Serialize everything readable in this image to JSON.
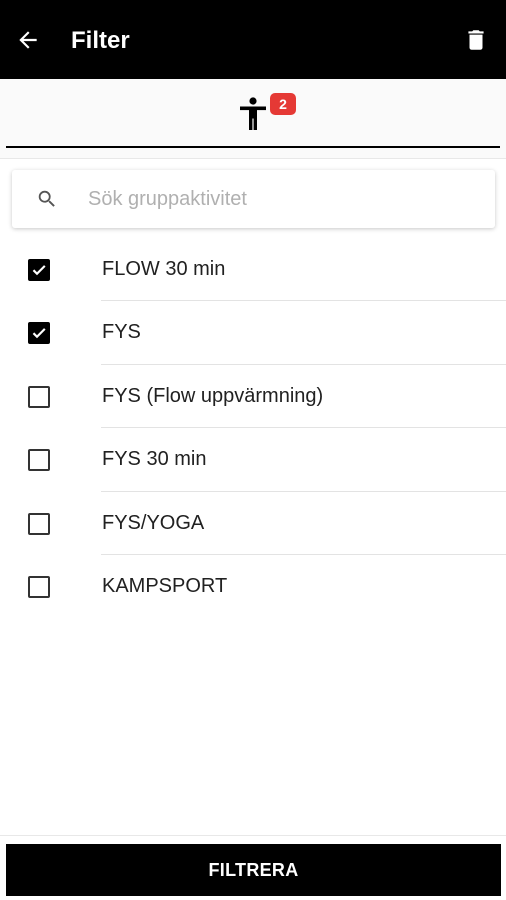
{
  "appbar": {
    "title": "Filter",
    "back_icon": "arrow-left-icon",
    "delete_icon": "trash-icon"
  },
  "tab": {
    "icon": "person-standing-icon",
    "badge_count": "2"
  },
  "search": {
    "icon": "search-icon",
    "placeholder": "Sök gruppaktivitet",
    "value": ""
  },
  "activities": [
    {
      "label": "FLOW 30 min",
      "checked": true
    },
    {
      "label": "FYS",
      "checked": true
    },
    {
      "label": "FYS (Flow uppvärmning)",
      "checked": false
    },
    {
      "label": "FYS 30 min",
      "checked": false
    },
    {
      "label": "FYS/YOGA",
      "checked": false
    },
    {
      "label": "KAMPSPORT",
      "checked": false
    }
  ],
  "footer": {
    "filter_button_label": "FILTRERA"
  },
  "colors": {
    "appbar_bg": "#000000",
    "badge_bg": "#e53935",
    "button_bg": "#000000"
  }
}
